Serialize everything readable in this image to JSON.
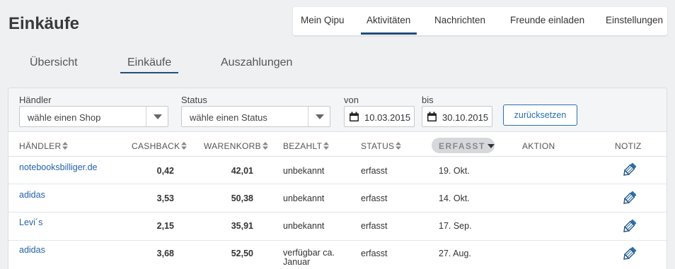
{
  "page": {
    "title": "Einkäufe"
  },
  "top_nav": [
    {
      "label": "Mein Qipu",
      "active": false
    },
    {
      "label": "Aktivitäten",
      "active": true
    },
    {
      "label": "Nachrichten",
      "active": false
    },
    {
      "label": "Freunde einladen",
      "active": false
    },
    {
      "label": "Einstellungen",
      "active": false
    }
  ],
  "sub_tabs": [
    {
      "label": "Übersicht",
      "active": false
    },
    {
      "label": "Einkäufe",
      "active": true
    },
    {
      "label": "Auszahlungen",
      "active": false
    }
  ],
  "filters": {
    "shop_label": "Händler",
    "shop_value": "wähle einen Shop",
    "status_label": "Status",
    "status_value": "wähle einen Status",
    "from_label": "von",
    "from_value": "10.03.2015",
    "to_label": "bis",
    "to_value": "30.10.2015",
    "reset_label": "zurücksetzen"
  },
  "table": {
    "headers": {
      "haendler": "HÄNDLER",
      "cashback": "CASHBACK",
      "warenkorb": "WARENKORB",
      "bezahlt": "BEZAHLT",
      "status": "STATUS",
      "erfasst": "ERFASST",
      "aktion": "AKTION",
      "notiz": "NOTIZ"
    },
    "rows": [
      {
        "shop": "notebooksbilliger.de",
        "cashback": "0,42",
        "warenkorb": "42,01",
        "bezahlt": "unbekannt",
        "status": "erfasst",
        "erfasst": "19. Okt."
      },
      {
        "shop": "adidas",
        "cashback": "3,53",
        "warenkorb": "50,38",
        "bezahlt": "unbekannt",
        "status": "erfasst",
        "erfasst": "14. Okt."
      },
      {
        "shop": "Levi´s",
        "cashback": "2,15",
        "warenkorb": "35,91",
        "bezahlt": "unbekannt",
        "status": "erfasst",
        "erfasst": "17. Sep."
      },
      {
        "shop": "adidas",
        "cashback": "3,68",
        "warenkorb": "52,50",
        "bezahlt": "verfügbar ca. Januar",
        "status": "erfasst",
        "erfasst": "27. Aug."
      }
    ]
  },
  "icons": {
    "sort": "sort-both-icon",
    "sort_active": "sort-down-icon",
    "dropdown": "chevron-down-icon",
    "calendar": "calendar-icon",
    "note": "pencil-icon"
  },
  "colors": {
    "link": "#2563a8",
    "accent": "#1f4e79",
    "button_border": "#2a6fb0",
    "background": "#eef0f2"
  }
}
